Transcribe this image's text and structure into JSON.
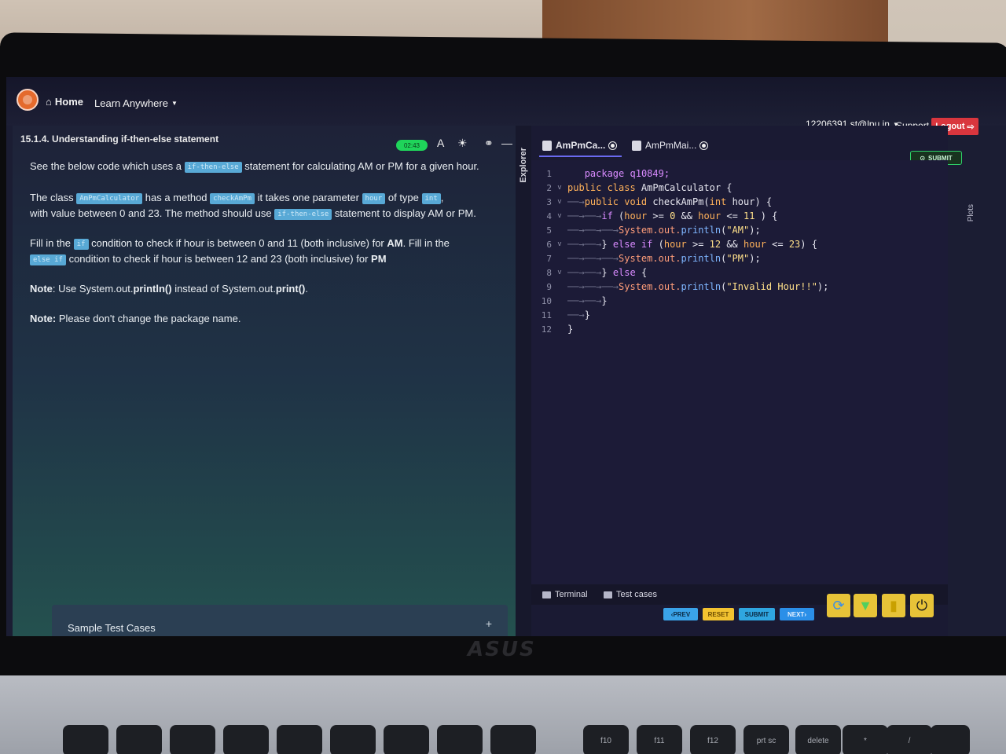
{
  "app": {
    "nav": {
      "home_label": "Home",
      "learn_label": "Learn Anywhere"
    },
    "user": {
      "email": "12206391.st@lpu.in",
      "support_label": "Support",
      "logout_label": "Logout"
    }
  },
  "problem": {
    "title": "15.1.4. Understanding if-then-else statement",
    "timer": "02:43",
    "para1_pre": "See the below code which uses a",
    "para1_chip": "if-then-else",
    "para1_post": "statement for calculating AM or PM for a given hour.",
    "para2_a": "The class",
    "para2_chip1": "AmPmCalculator",
    "para2_b": "has a method",
    "para2_chip2": "checkAmPm",
    "para2_c": "it takes one parameter",
    "para2_chip3": "hour",
    "para2_d": "of type",
    "para2_chip4": "int",
    "para2_e": ",",
    "para2_f": "with value between 0 and 23. The method should use",
    "para2_chip5": "if-then-else",
    "para2_g": "statement to display AM or PM.",
    "para3_a": "Fill in the",
    "para3_chip1": "if",
    "para3_b": "condition to check if hour is between 0 and 11 (both inclusive) for",
    "para3_am": "AM",
    "para3_c": ". Fill in the",
    "para3_chip2": "else if",
    "para3_d": "condition to check if hour is between 12 and 23 (both inclusive) for",
    "para3_pm": "PM",
    "note1_label": "Note",
    "note1_a": ": Use System.out.",
    "note1_b": "println()",
    "note1_c": " instead of System.out.",
    "note1_d": "print()",
    "note1_e": ".",
    "note2_label": "Note:",
    "note2_text": " Please don't change the package name.",
    "sample_label": "Sample Test Cases",
    "sample_plus": "+"
  },
  "explorer": {
    "label": "Explorer"
  },
  "editor": {
    "tabs": [
      {
        "label": "AmPmCa..."
      },
      {
        "label": "AmPmMai..."
      }
    ],
    "submit_label": "SUBMIT",
    "plots_label": "Plots",
    "line_numbers": [
      "1",
      "2",
      "3",
      "4",
      "5",
      "6",
      "7",
      "8",
      "9",
      "10",
      "11",
      "12"
    ],
    "lines": {
      "l1_kw": "package",
      "l1_rest": " q10849;",
      "l2_kw": "public class",
      "l2_rest": " AmPmCalculator {",
      "l3_kw": "public void",
      "l3_rest": " checkAmPm(",
      "l3_type": "int",
      "l3_end": " hour) {",
      "l4_kw": "if",
      "l4_a": " (",
      "l4_v1": "hour",
      "l4_b": " >= ",
      "l4_n1": "0",
      "l4_c": " && ",
      "l4_v2": "hour",
      "l4_d": " <= ",
      "l4_n2": "11",
      "l4_e": " ) {",
      "l5_obj": "System",
      "l5_mid": ".out.",
      "l5_fn": "println",
      "l5_a": "(",
      "l5_str": "\"AM\"",
      "l5_b": ");",
      "l6_a": "} ",
      "l6_kw": "else if",
      "l6_b": " (",
      "l6_v1": "hour",
      "l6_c": " >= ",
      "l6_n1": "12",
      "l6_d": " && ",
      "l6_v2": "hour",
      "l6_e": " <= ",
      "l6_n2": "23",
      "l6_f": ") {",
      "l7_obj": "System",
      "l7_mid": ".out.",
      "l7_fn": "println",
      "l7_a": "(",
      "l7_str": "\"PM\"",
      "l7_b": ");",
      "l8_a": "} ",
      "l8_kw": "else",
      "l8_b": " {",
      "l9_obj": "System",
      "l9_mid": ".out.",
      "l9_fn": "println",
      "l9_a": "(",
      "l9_str": "\"Invalid Hour!!\"",
      "l9_b": ");",
      "l10": "}",
      "l11": "}",
      "l12": "}"
    }
  },
  "console": {
    "terminal_label": "Terminal",
    "testcases_label": "Test cases"
  },
  "footer_buttons": {
    "prev": "PREV",
    "reset": "RESET",
    "submit": "SUBMIT",
    "next": "NEXT"
  },
  "colors": {
    "accent": "#58a9d6",
    "logout": "#d9363e",
    "submit_green": "#2fd46a",
    "reset_yellow": "#f2c230"
  },
  "device": {
    "brand": "ASUS",
    "keys": [
      "",
      "",
      "",
      "",
      "",
      "",
      "",
      "",
      "",
      "f10",
      "f11",
      "f12",
      "prt sc",
      "delete",
      "*",
      "/",
      ""
    ]
  }
}
